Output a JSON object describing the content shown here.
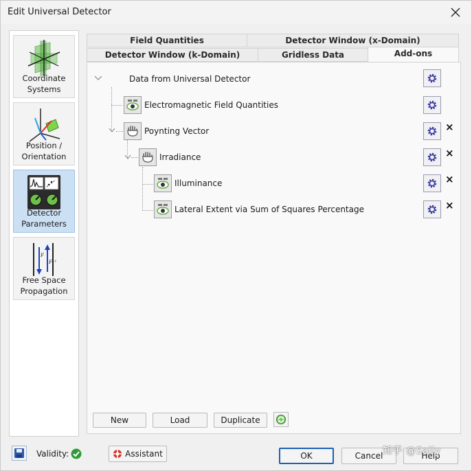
{
  "window": {
    "title": "Edit Universal Detector"
  },
  "nav": [
    {
      "label": "Coordinate\nSystems",
      "icon": "coordinate-systems-icon"
    },
    {
      "label": "Position /\nOrientation",
      "icon": "position-orientation-icon"
    },
    {
      "label": "Detector\nParameters",
      "icon": "detector-parameters-icon",
      "active": true
    },
    {
      "label": "Free Space\nPropagation",
      "icon": "free-space-propagation-icon"
    }
  ],
  "tabs": {
    "row1": [
      "Field Quantities",
      "Detector Window (x-Domain)"
    ],
    "row2": [
      "Detector Window (k-Domain)",
      "Gridless Data",
      "Add-ons"
    ],
    "active": "Add-ons"
  },
  "tree": {
    "root": "Data from Universal Detector",
    "nodes": [
      "Electromagnetic Field Quantities",
      "Poynting Vector",
      "Irradiance",
      "Illuminance",
      "Lateral Extent via Sum of Squares Percentage"
    ],
    "remove_symbol": "×"
  },
  "actions": {
    "new": "New",
    "load": "Load",
    "duplicate": "Duplicate"
  },
  "footer": {
    "validity_label": "Validity:",
    "assistant": "Assistant",
    "ok": "OK",
    "cancel": "Cancel",
    "help": "Help"
  },
  "watermark": "知乎 @Sally",
  "colors": {
    "accent": "#1a5fb4",
    "gear": "#3a3aa0",
    "valid": "#2e9b36",
    "active_nav": "#cce0f4"
  }
}
